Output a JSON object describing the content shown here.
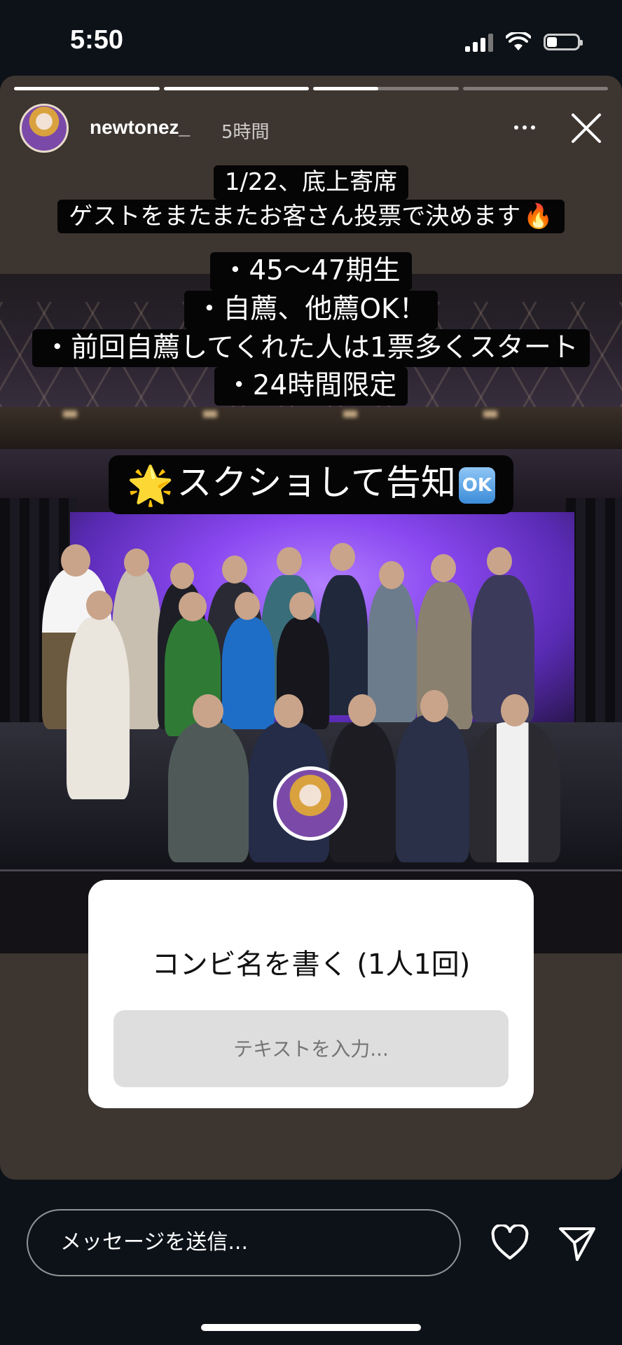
{
  "status_bar": {
    "time": "5:50",
    "icons": [
      "cellular-signal-icon",
      "wifi-icon",
      "battery-icon"
    ],
    "battery_level": 0.34
  },
  "story": {
    "progress_segments": [
      1.0,
      1.0,
      0.45,
      0.0
    ],
    "username": "newtonez_",
    "time_ago": "5時間",
    "icons": [
      "more-options-icon",
      "close-icon"
    ],
    "captions": {
      "block1": [
        "1/22、底上寄席",
        "ゲストをまたまたお客さん投票で決めます"
      ],
      "block1_emoji": "🔥",
      "block2": [
        "・45〜47期生",
        "・自薦、他薦OK！",
        "・前回自薦してくれた人は1票多くスタート",
        "・24時間限定"
      ],
      "block3_text": "スクショして告知",
      "block3_leading_emoji": "🌟",
      "block3_badge": "OK"
    },
    "question_sticker": {
      "title": "コンビ名を書く (1人1回)",
      "placeholder": "テキストを入力..."
    }
  },
  "bottom_bar": {
    "message_placeholder": "メッセージを送信...",
    "icons": [
      "heart-icon",
      "send-icon"
    ]
  },
  "colors": {
    "background": "#0d1218",
    "story_background": "#3d3530",
    "caption_background": "#050505",
    "stage_purple": "#8a48f0",
    "sticker_input": "#dedede"
  }
}
